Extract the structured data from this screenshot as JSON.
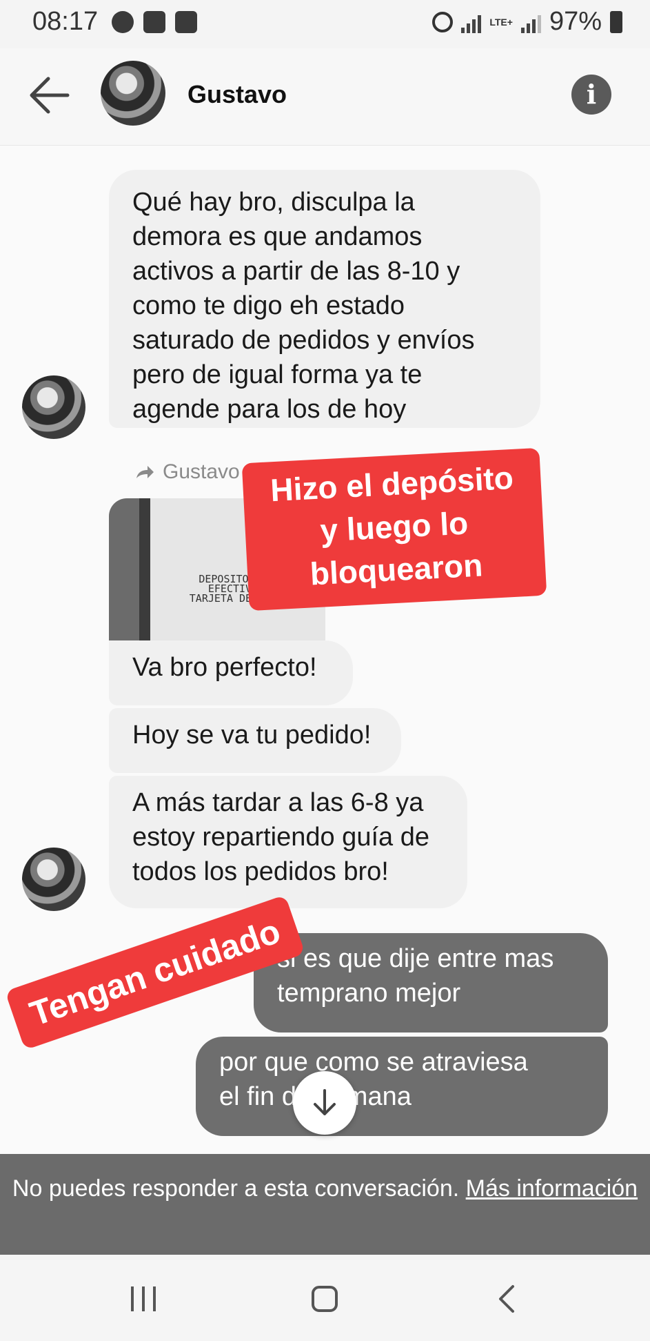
{
  "status_bar": {
    "time": "08:17",
    "lte": "LTE+",
    "battery": "97%"
  },
  "header": {
    "contact_name": "Gustavo",
    "info_icon": "i"
  },
  "messages": [
    {
      "direction": "incoming",
      "text": "Qué hay bro, disculpa la\ndemora es que andamos\nactivos a partir de las 8-10 y\ncomo te digo eh estado\nsaturado de pedidos y envíos\npero de igual forma ya te\nagende para los de hoy"
    },
    {
      "direction": "incoming",
      "forwarded_label": "Gustavo te",
      "attachment": "receipt-photo",
      "receipt_heading": "DEPOSITO EN\nEFECTIVO\nTARJETA DEBITO"
    },
    {
      "direction": "incoming",
      "text": "Va bro perfecto!"
    },
    {
      "direction": "incoming",
      "text": "Hoy se va tu pedido!"
    },
    {
      "direction": "incoming",
      "text": "A más tardar a las 6-8 ya\nestoy repartiendo guía de\ntodos los pedidos bro!"
    },
    {
      "direction": "outgoing",
      "text": "si es que dije  entre mas\ntemprano mejor"
    },
    {
      "direction": "outgoing",
      "text": "por  que como  se atraviesa\nel fin de semana"
    }
  ],
  "stickers": {
    "first": "Hizo el depósito\ny luego lo\nbloquearon",
    "second": "Tengan cuidado"
  },
  "notice": {
    "text": "No puedes responder a esta conversación.",
    "link": "Más información"
  },
  "colors": {
    "incoming_bubble": "#f0f0f0",
    "outgoing_bubble": "#6e6e6e",
    "sticker": "#ef3b3b",
    "notice_bar": "#6b6b6b"
  }
}
